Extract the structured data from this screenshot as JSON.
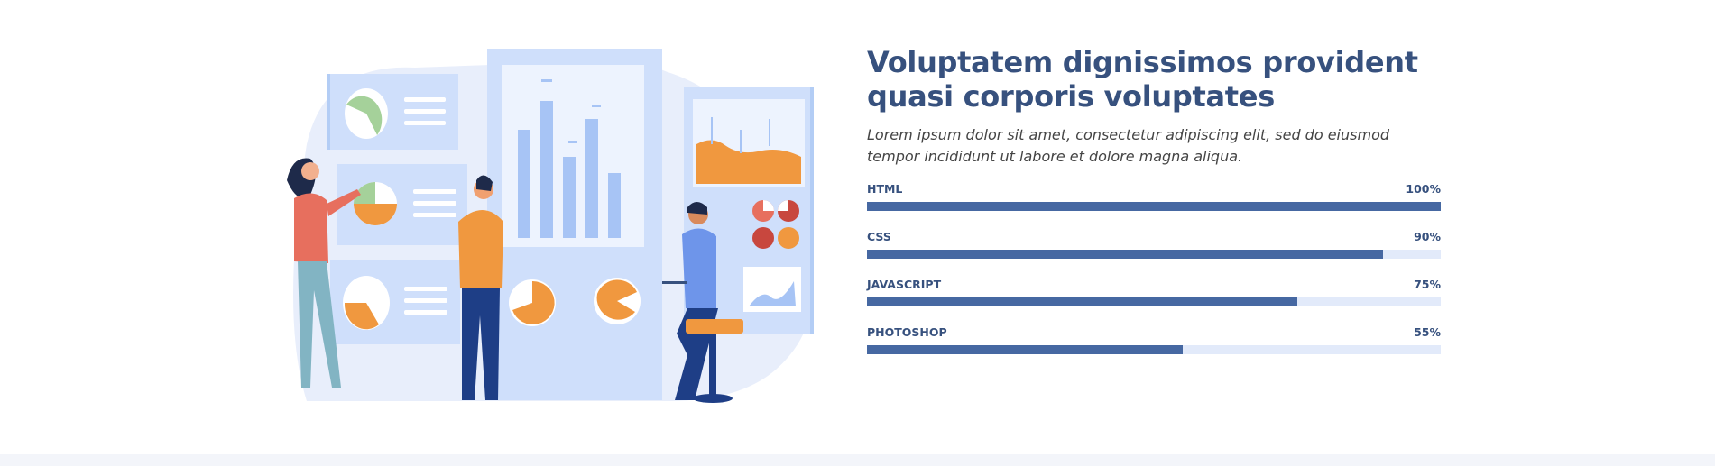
{
  "about": {
    "title_line1": "Voluptatem dignissimos provident",
    "title_line2": "quasi corporis voluptates",
    "description": "Lorem ipsum dolor sit amet, consectetur adipiscing elit, sed do eiusmod tempor incididunt ut labore et dolore magna aliqua."
  },
  "skills": [
    {
      "name": "HTML",
      "percent_label": "100%",
      "value": 100
    },
    {
      "name": "CSS",
      "percent_label": "90%",
      "value": 90
    },
    {
      "name": "JAVASCRIPT",
      "percent_label": "75%",
      "value": 75
    },
    {
      "name": "PHOTOSHOP",
      "percent_label": "55%",
      "value": 55
    }
  ],
  "colors": {
    "heading": "#37517e",
    "bar_fill": "#4668a2",
    "bar_track": "#e2eafa",
    "illustration_orange": "#f0983f",
    "illustration_blue": "#a7c4f5"
  }
}
